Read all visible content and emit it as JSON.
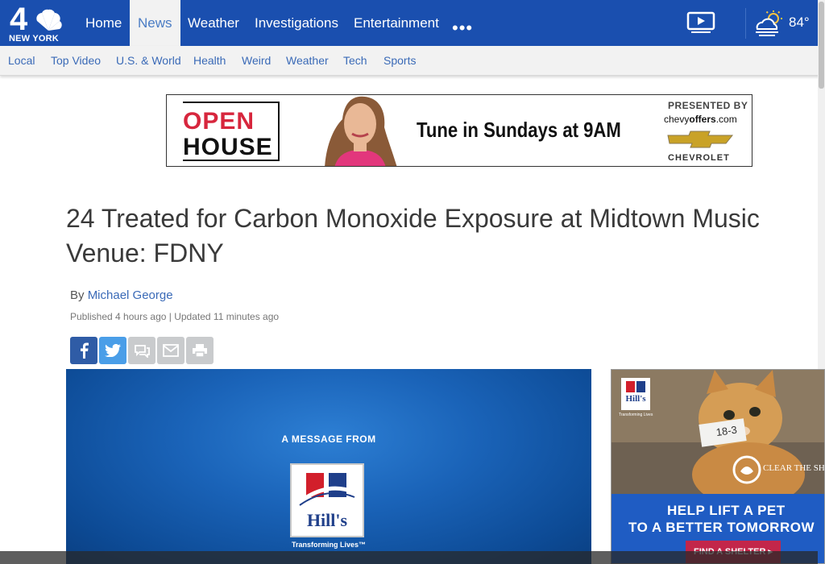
{
  "brand": {
    "logo_text": "NEW YORK",
    "logo_number": "4",
    "primary_color": "#1a4faf",
    "accent_color": "#3a6ab7"
  },
  "nav": {
    "items": [
      {
        "label": "Home"
      },
      {
        "label": "News"
      },
      {
        "label": "Weather"
      },
      {
        "label": "Investigations"
      },
      {
        "label": "Entertainment"
      }
    ],
    "more_label": "•••",
    "active": "News"
  },
  "weather": {
    "temp": "84°",
    "icon": "partly-cloudy-sun-icon"
  },
  "subnav": {
    "items": [
      {
        "label": "Local"
      },
      {
        "label": "Top Video"
      },
      {
        "label": "U.S. & World"
      },
      {
        "label": "Health"
      },
      {
        "label": "Weird"
      },
      {
        "label": "Weather"
      },
      {
        "label": "Tech"
      },
      {
        "label": "Sports"
      }
    ]
  },
  "banner_ad": {
    "open": "OPEN",
    "house": "HOUSE",
    "tagline": "Tune in Sundays at 9AM",
    "presented_by": "PRESENTED BY",
    "site_prefix": "chevy",
    "site_bold": "offers",
    "site_suffix": ".com",
    "sponsor": "CHEVROLET"
  },
  "article": {
    "headline": "24 Treated for Carbon Monoxide Exposure at Midtown Music Venue: FDNY",
    "by": "By",
    "author": "Michael George",
    "published": "Published 4 hours ago | Updated 11 minutes ago"
  },
  "share": {
    "buttons": [
      "facebook-icon",
      "twitter-icon",
      "comment-icon",
      "email-icon",
      "print-icon"
    ]
  },
  "video_ad": {
    "message_from": "A MESSAGE FROM",
    "brand": "Hill's",
    "tagline": "Transforming Lives™"
  },
  "side_ad": {
    "headline_line1": "HELP LIFT A PET",
    "headline_line2": "TO A BETTER TOMORROW",
    "cta": "FIND A SHELTER ▸",
    "brand": "Hill's",
    "brand_tagline": "Transforming Lives",
    "partner": "CLEAR THE SHELTERS",
    "tag": "18-3"
  }
}
